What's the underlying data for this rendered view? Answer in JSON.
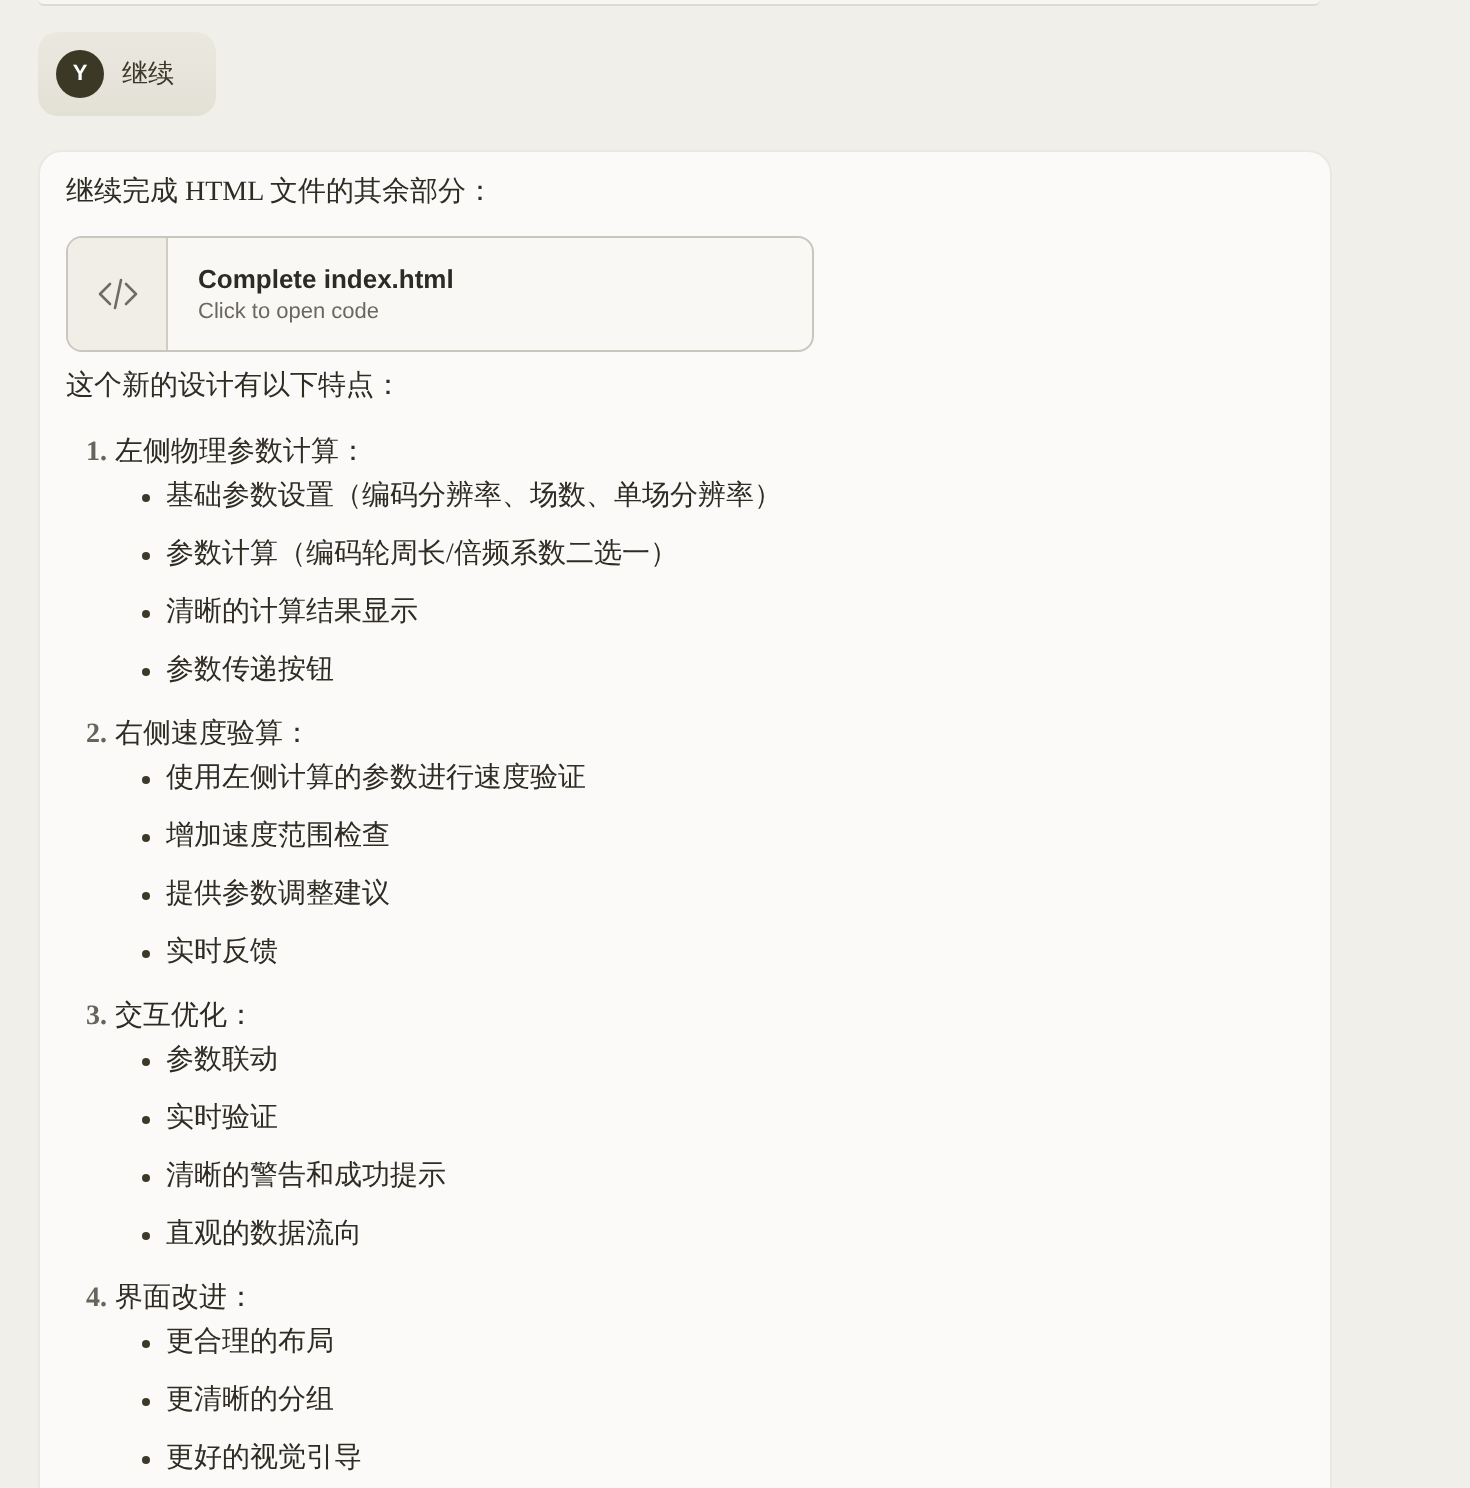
{
  "user_message": {
    "avatar_letter": "Y",
    "text": "继续"
  },
  "response": {
    "intro": "继续完成 HTML 文件的其余部分：",
    "artifact": {
      "title": "Complete index.html",
      "subtitle": "Click to open code"
    },
    "summary": "这个新的设计有以下特点：",
    "features": [
      {
        "number": "1.",
        "title": "左侧物理参数计算：",
        "points": [
          "基础参数设置（编码分辨率、场数、单场分辨率）",
          "参数计算（编码轮周长/倍频系数二选一）",
          "清晰的计算结果显示",
          "参数传递按钮"
        ]
      },
      {
        "number": "2.",
        "title": "右侧速度验算：",
        "points": [
          "使用左侧计算的参数进行速度验证",
          "增加速度范围检查",
          "提供参数调整建议",
          "实时反馈"
        ]
      },
      {
        "number": "3.",
        "title": "交互优化：",
        "points": [
          "参数联动",
          "实时验证",
          "清晰的警告和成功提示",
          "直观的数据流向"
        ]
      },
      {
        "number": "4.",
        "title": "界面改进：",
        "points": [
          "更合理的布局",
          "更清晰的分组",
          "更好的视觉引导"
        ]
      }
    ]
  }
}
